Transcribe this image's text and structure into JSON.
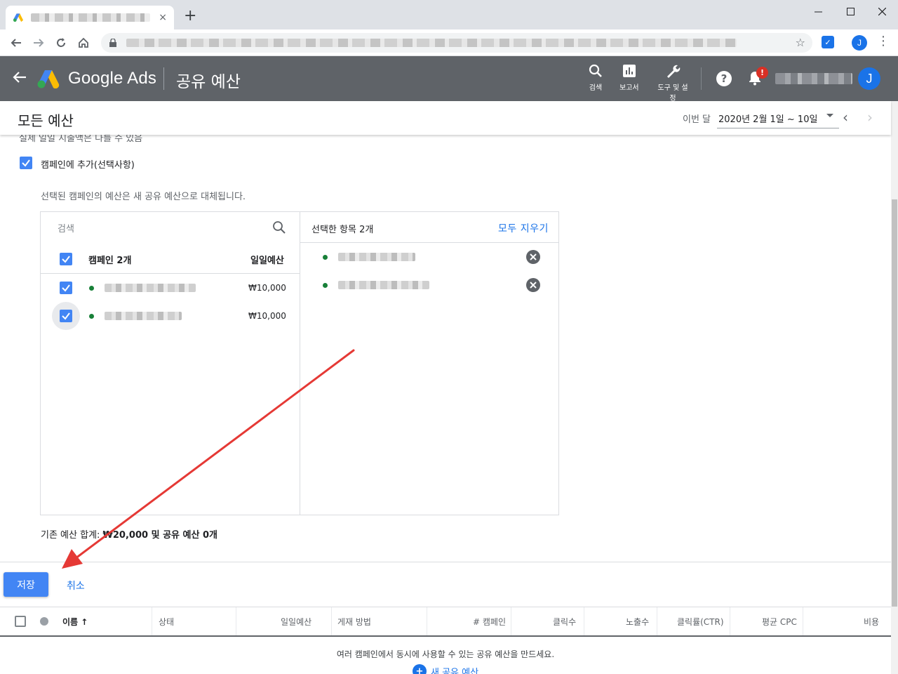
{
  "browser": {
    "new_tab": "+",
    "tab_close": "×",
    "profile_initial": "J"
  },
  "ads_header": {
    "brand": "Google Ads",
    "page_name": "공유 예산",
    "search_label": "검색",
    "reports_label": "보고서",
    "tools_label": "도구 및 설정",
    "notification_badge": "!",
    "account_initial": "J"
  },
  "subheader": {
    "title": "모든 예산",
    "range_label": "이번 달",
    "range_value": "2020년 2월 1일 ~ 10일"
  },
  "form": {
    "cut_text": "실제 일일 지출액은 다를 수 있음",
    "add_to_campaigns_label": "캠페인에 추가(선택사항)",
    "replace_note": "선택된 캠페인의 예산은 새 공유 예산으로 대체됩니다.",
    "picker": {
      "search_placeholder": "검색",
      "campaign_count": "캠페인 2개",
      "daily_budget_header": "일일예산",
      "rows": [
        {
          "amount": "₩10,000"
        },
        {
          "amount": "₩10,000"
        }
      ],
      "selected_title": "선택한 항목 2개",
      "clear_all": "모두 지우기"
    },
    "summary_prefix": "기존 예산 합계: ",
    "summary_bold": "₩20,000 및 공유 예산 0개",
    "save_label": "저장",
    "cancel_label": "취소"
  },
  "table": {
    "columns": [
      "이름",
      "상태",
      "일일예산",
      "게재 방법",
      "# 캠페인",
      "클릭수",
      "노출수",
      "클릭률(CTR)",
      "평균 CPC",
      "비용"
    ],
    "empty_message": "여러 캠페인에서 동시에 사용할 수 있는 공유 예산을 만드세요.",
    "new_budget_label": "새 공유 예산"
  },
  "annotation_color": "#e53935",
  "accent_color": "#4285f4"
}
